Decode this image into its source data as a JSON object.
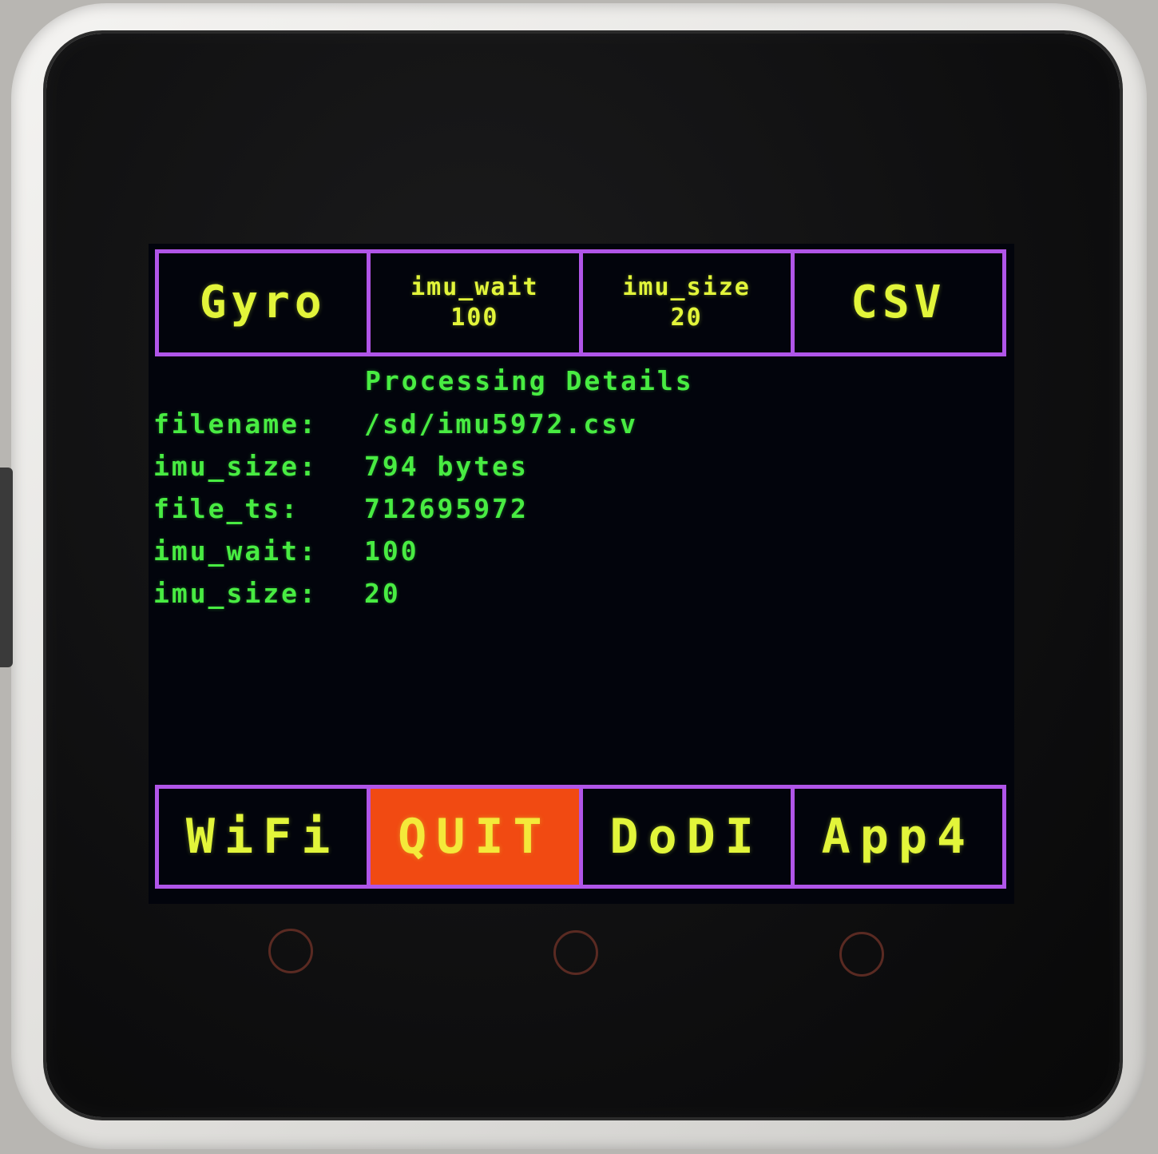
{
  "top_buttons": [
    {
      "label": "Gyro"
    },
    {
      "label": "imu_wait",
      "value": "100"
    },
    {
      "label": "imu_size",
      "value": "20"
    },
    {
      "label": "CSV"
    }
  ],
  "details": {
    "title": "Processing Details",
    "rows": [
      {
        "key": "filename:",
        "value": "/sd/imu5972.csv"
      },
      {
        "key": "imu_size:",
        "value": "794 bytes"
      },
      {
        "key": "file_ts:",
        "value": "712695972"
      },
      {
        "key": "imu_wait:",
        "value": "100"
      },
      {
        "key": "imu_size:",
        "value": "20"
      }
    ]
  },
  "bottom_buttons": [
    {
      "label": "WiFi"
    },
    {
      "label": "QUIT",
      "active": true
    },
    {
      "label": "DoDI"
    },
    {
      "label": "App4"
    }
  ],
  "colors": {
    "accent_border": "#b055e8",
    "button_text": "#e2f53a",
    "detail_text": "#48ec42",
    "active_button": "#f14a12",
    "screen_bg": "#02040c"
  }
}
